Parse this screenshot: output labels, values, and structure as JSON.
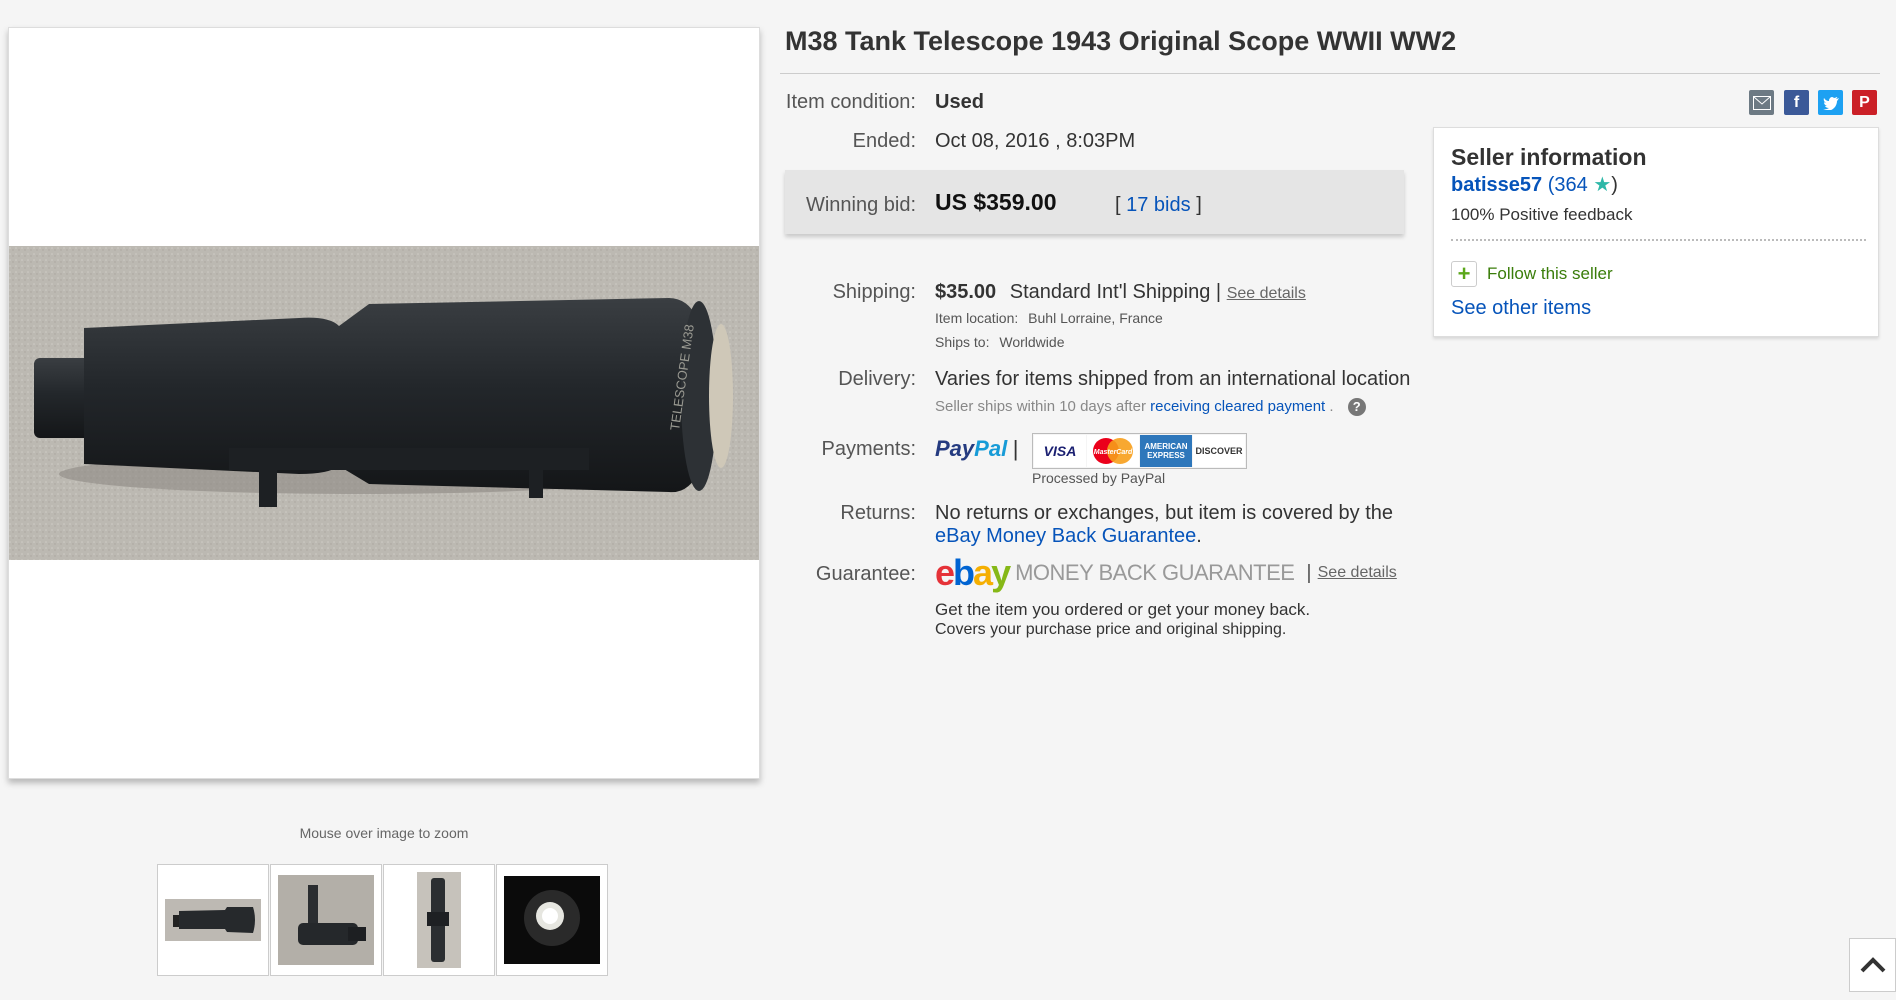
{
  "listing": {
    "title": "M38 Tank Telescope 1943 Original Scope WWII WW2",
    "zoom_hint": "Mouse over image to zoom",
    "thumbnail_count": 4
  },
  "details": {
    "condition_label": "Item condition:",
    "condition_value": "Used",
    "ended_label": "Ended:",
    "ended_value": "Oct 08, 2016 , 8:03PM",
    "winning_label": "Winning bid:",
    "winning_value": "US $359.00",
    "bids_open": "[",
    "bids_link": "17 bids",
    "bids_close": "]",
    "shipping_label": "Shipping:",
    "shipping_cost": "$35.00",
    "shipping_method": "Standard Int'l Shipping |",
    "shipping_see_details": "See details",
    "item_location_label": "Item location:",
    "item_location_value": "Buhl Lorraine, France",
    "ships_to_label": "Ships to:",
    "ships_to_value": "Worldwide",
    "delivery_label": "Delivery:",
    "delivery_value": "Varies for items shipped from an international location",
    "delivery_note": "Seller ships within 10 days after",
    "delivery_link": "receiving cleared payment",
    "delivery_after": ".",
    "payments_label": "Payments:",
    "paypal_part1": "Pay",
    "paypal_part2": "Pal",
    "paypal_sep": "|",
    "processed_by": "Processed by PayPal",
    "returns_label": "Returns:",
    "returns_text": "No returns or exchanges, but item is covered by the",
    "returns_link": "eBay Money Back Guarantee",
    "returns_end": ".",
    "guarantee_label": "Guarantee:",
    "guarantee_logo_text": "MONEY BACK GUARANTEE",
    "guarantee_sep": "|",
    "guarantee_see_details": "See details",
    "guarantee_line1": "Get the item you ordered or get your money back.",
    "guarantee_line2": "Covers your purchase price and original shipping."
  },
  "cards": [
    "VISA",
    "MasterCard",
    "AMERICAN EXPRESS",
    "DISCOVER"
  ],
  "seller": {
    "heading": "Seller information",
    "username": "batisse57",
    "score_open": "(",
    "score": "364",
    "score_close": ")",
    "feedback": "100% Positive feedback",
    "follow": "Follow this seller",
    "other_items": "See other items"
  },
  "share_icons": [
    "email-icon",
    "facebook-icon",
    "twitter-icon",
    "pinterest-icon"
  ],
  "colors": {
    "link": "#0654ba",
    "follow_green": "#3a7d0a",
    "star": "#2eb8a8",
    "facebook": "#3b5998",
    "twitter": "#1da1f2",
    "pinterest": "#cb2027",
    "email": "#6d7a84"
  }
}
